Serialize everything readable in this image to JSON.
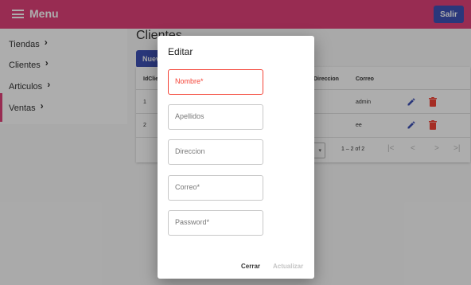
{
  "header": {
    "title": "Menu",
    "logout_label": "Salir"
  },
  "sidebar": {
    "items": [
      {
        "label": "Tiendas"
      },
      {
        "label": "Clientes"
      },
      {
        "label": "Articulos"
      },
      {
        "label": "Ventas"
      }
    ]
  },
  "main": {
    "title": "Clientes",
    "new_button_label": "Nuevo",
    "table": {
      "headers": {
        "id": "IdCliente",
        "address": "Direccion",
        "email": "Correo"
      },
      "rows": [
        {
          "id": "1",
          "email": "admin"
        },
        {
          "id": "2",
          "email": "ee"
        }
      ]
    },
    "pagination": {
      "range": "1 – 2 of 2",
      "first": "|<",
      "prev": "<",
      "next": ">",
      "last": ">|"
    }
  },
  "dialog": {
    "title": "Editar",
    "fields": {
      "nombre": {
        "placeholder": "Nombre*"
      },
      "apellidos": {
        "placeholder": "Apellidos"
      },
      "direccion": {
        "placeholder": "Direccion"
      },
      "correo": {
        "placeholder": "Correo*"
      },
      "password": {
        "placeholder": "Password*"
      }
    },
    "cancel_label": "Cerrar",
    "update_label": "Actualizar"
  },
  "colors": {
    "toolbar": "#e0417a",
    "primary": "#3f51b5",
    "warn": "#f44336"
  }
}
